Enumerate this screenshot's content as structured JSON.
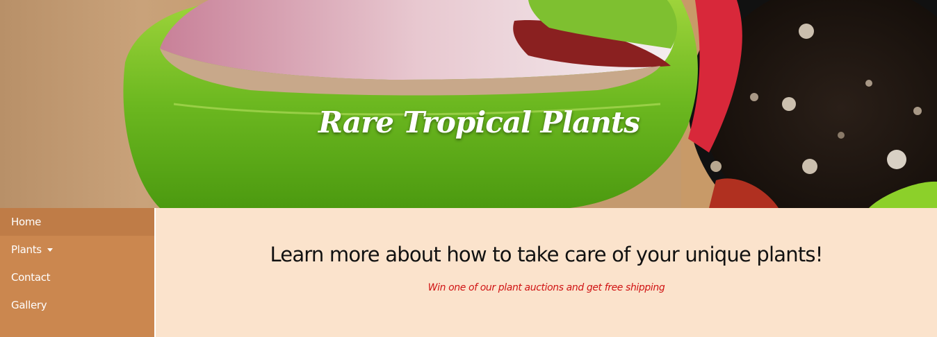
{
  "header": {
    "site_title": "Rare Tropical Plants",
    "hero_image": "variegated-leaf-photo"
  },
  "sidebar": {
    "items": [
      {
        "label": "Home",
        "active": true
      },
      {
        "label": "Plants",
        "has_dropdown": true,
        "icon": "caret-down-icon"
      },
      {
        "label": "Contact"
      },
      {
        "label": "Gallery"
      }
    ]
  },
  "main": {
    "heading": "Learn more about how to take care of your unique plants!",
    "subheading": "Win one of our plant auctions and get free shipping"
  },
  "colors": {
    "sidebar_bg": "#cb874f",
    "sidebar_active_bg": "#bf7c47",
    "main_bg": "#fbe3cc",
    "subheading_text": "#d01313",
    "heading_text": "#111111"
  }
}
